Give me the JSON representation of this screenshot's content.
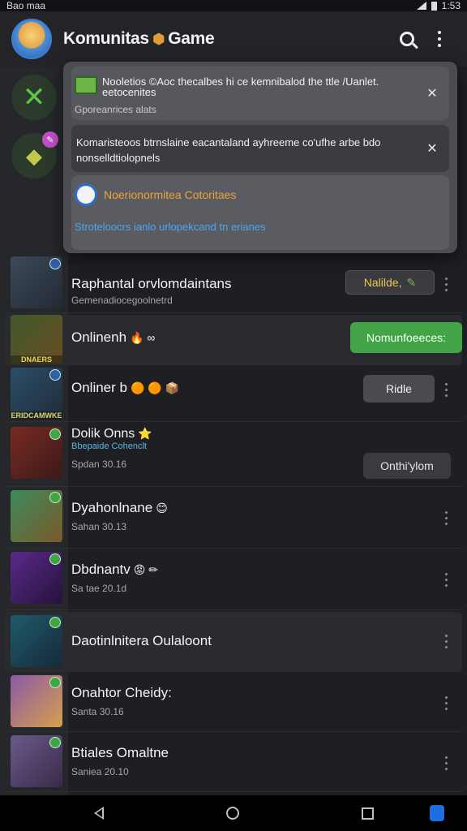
{
  "status_bar": {
    "left": "Bao maa",
    "time": "1:53"
  },
  "app_bar": {
    "title": "Komunitas",
    "title_suffix": "Game",
    "icons": [
      "avatar",
      "search-icon",
      "more-vert-icon"
    ]
  },
  "notifications": [
    {
      "text": "Nooletios ©Aoc thecalbes hi ce kemnibalod the ttle /Uanlet. eetocenites",
      "subtext": "Gporeanrices alats",
      "icon": "community-icon"
    },
    {
      "text": "Komaristeoos btrnslaine eacantaland ayhreeme co'ufhe arbe bdo nonselldtiolopnels"
    },
    {
      "title": "Noerionormitea Cotoritaes",
      "link": "Stroteloocrs ianlo urlopekcand tn erianes",
      "icon": "globe-icon"
    }
  ],
  "games": [
    {
      "title": "Raphantal orvlomdaintans",
      "subtitle": "Gemenadiocegoolnetrd",
      "action": "Nalilde,",
      "thumb_caption": ""
    },
    {
      "title": "Onlinenh",
      "suffix": "🔥 ∞",
      "action": "Nomunfoeeces:",
      "thumb_caption": "DNAERS"
    },
    {
      "title": "Onliner b",
      "suffix": "🟠 🟠 📦",
      "action": "Ridle",
      "thumb_caption": "ERIDCAMWKE"
    },
    {
      "title": "Dolik Onns",
      "suffix": "⭐",
      "tag": "Bbepaide Cohenclt",
      "subtitle": "Spdan 30.16",
      "action": "Onthi'ylom"
    },
    {
      "title": "Dyahonlnane",
      "suffix": "😊",
      "subtitle": "Sahan 30.13"
    },
    {
      "title": "Dbdnantv",
      "suffix": "😡 ✏",
      "subtitle": "Sa tae 20.1d"
    },
    {
      "title": "Daotinlnitera Oulaloont"
    },
    {
      "title": "Onahtor Cheidy:",
      "subtitle": "Santa 30.16"
    },
    {
      "title": "Btiales Omaltne",
      "subtitle": "Saniea 20.10"
    }
  ],
  "colors": {
    "accent_green": "#43a447",
    "accent_orange": "#f0a13a",
    "link_blue": "#4aa6f0"
  }
}
